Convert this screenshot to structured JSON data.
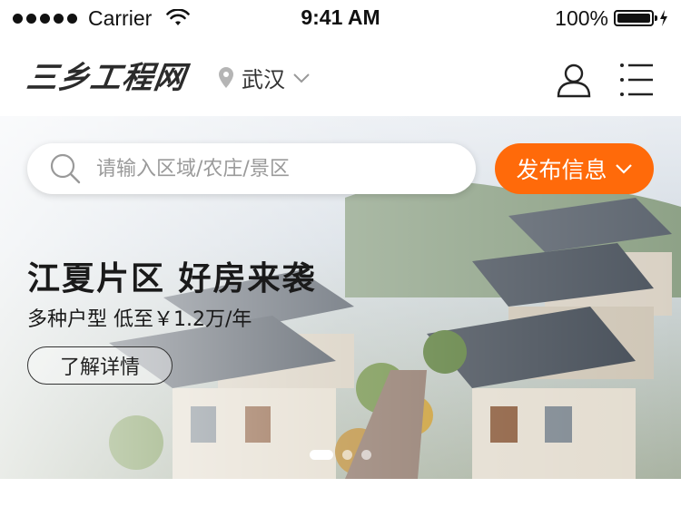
{
  "status_bar": {
    "carrier": "Carrier",
    "time": "9:41 AM",
    "battery": "100%"
  },
  "header": {
    "logo": "三乡工程网",
    "city": "武汉"
  },
  "search": {
    "placeholder": "请输入区域/农庄/景区"
  },
  "publish_button": {
    "label": "发布信息"
  },
  "banner": {
    "headline": "江夏片区 好房来袭",
    "subline": "多种户型 低至￥1.2万/年",
    "cta": "了解详情",
    "slide_count": 3,
    "active_slide": 1
  },
  "colors": {
    "accent": "#ff6a0a",
    "text": "#1a1a1a"
  }
}
